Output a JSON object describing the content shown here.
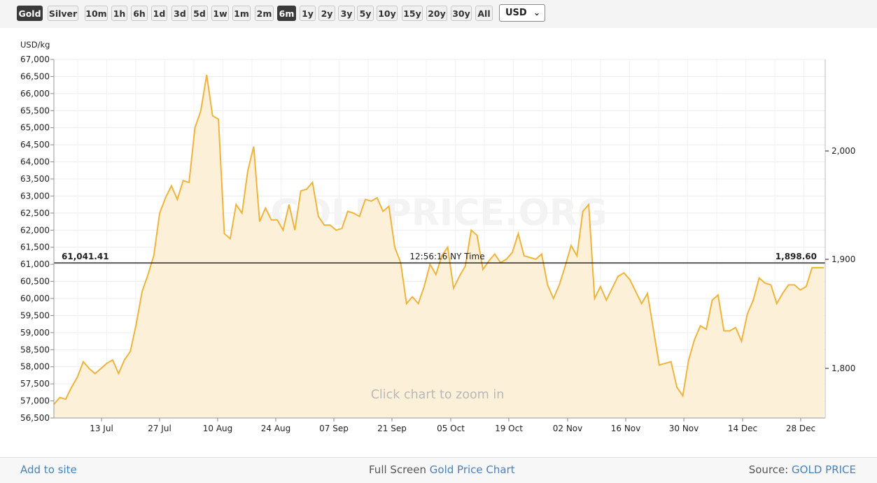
{
  "toolbar": {
    "metals": [
      {
        "label": "Gold",
        "active": true
      },
      {
        "label": "Silver",
        "active": false
      }
    ],
    "ranges": [
      {
        "label": "10m",
        "active": false
      },
      {
        "label": "1h",
        "active": false
      },
      {
        "label": "6h",
        "active": false
      },
      {
        "label": "1d",
        "active": false
      },
      {
        "label": "3d",
        "active": false
      },
      {
        "label": "5d",
        "active": false
      },
      {
        "label": "1w",
        "active": false
      },
      {
        "label": "1m",
        "active": false
      },
      {
        "label": "2m",
        "active": false
      },
      {
        "label": "6m",
        "active": true
      },
      {
        "label": "1y",
        "active": false
      },
      {
        "label": "2y",
        "active": false
      },
      {
        "label": "3y",
        "active": false
      },
      {
        "label": "5y",
        "active": false
      },
      {
        "label": "10y",
        "active": false
      },
      {
        "label": "15y",
        "active": false
      },
      {
        "label": "20y",
        "active": false
      },
      {
        "label": "30y",
        "active": false
      },
      {
        "label": "All",
        "active": false
      }
    ],
    "currency": "USD",
    "currency_icon": "chevron-down-icon"
  },
  "chart_data": {
    "type": "area",
    "ylabel": "USD/kg",
    "ylim": [
      56500,
      67000
    ],
    "y_ticks": [
      56500,
      57000,
      57500,
      58000,
      58500,
      59000,
      59500,
      60000,
      60500,
      61000,
      61500,
      62000,
      62500,
      63000,
      63500,
      64000,
      64500,
      65000,
      65500,
      66000,
      66500,
      67000
    ],
    "y_tick_labels": [
      "56,500",
      "57,000",
      "57,500",
      "58,000",
      "58,500",
      "59,000",
      "59,500",
      "60,000",
      "60,500",
      "61,000",
      "61,500",
      "62,000",
      "62,500",
      "63,000",
      "63,500",
      "64,000",
      "64,500",
      "65,000",
      "65,500",
      "66,000",
      "66,500",
      "67,000"
    ],
    "y2_ticks": [
      1800,
      1900,
      2000
    ],
    "y2_tick_labels": [
      "1,800",
      "1,900",
      "2,000"
    ],
    "x_tick_labels": [
      "13 Jul",
      "27 Jul",
      "10 Aug",
      "24 Aug",
      "07 Sep",
      "21 Sep",
      "05 Oct",
      "19 Oct",
      "02 Nov",
      "16 Nov",
      "30 Nov",
      "14 Dec",
      "28 Dec"
    ],
    "line_color": "#f0b43c",
    "fill_color": "#fdf0d8",
    "current_value": 61041.41,
    "current_value_label": "61,041.41",
    "current_value_usd_oz_label": "1,898.60",
    "crosshair_time": "12:56:16 NY Time",
    "watermark": "GOLDPRICE.ORG",
    "zoom_hint": "Click chart to zoom in",
    "values": [
      56900,
      57100,
      57050,
      57400,
      57700,
      58150,
      57950,
      57800,
      57950,
      58100,
      58200,
      57800,
      58200,
      58450,
      59250,
      60200,
      60700,
      61250,
      62500,
      62950,
      63300,
      62900,
      63450,
      63400,
      65000,
      65500,
      66550,
      65350,
      65250,
      61900,
      61750,
      62750,
      62500,
      63750,
      64450,
      62250,
      62650,
      62300,
      62300,
      62000,
      62750,
      62000,
      63150,
      63200,
      63400,
      62400,
      62150,
      62150,
      62000,
      62050,
      62550,
      62500,
      62400,
      62900,
      62850,
      62950,
      62550,
      62700,
      61500,
      61050,
      59850,
      60050,
      59850,
      60350,
      61000,
      60700,
      61250,
      61500,
      60300,
      60650,
      60950,
      62000,
      61850,
      60850,
      61100,
      61300,
      61050,
      61150,
      61350,
      61900,
      61250,
      61200,
      61150,
      61300,
      60400,
      60000,
      60400,
      60950,
      61550,
      61250,
      62550,
      62750,
      60000,
      60350,
      59950,
      60300,
      60650,
      60750,
      60550,
      60200,
      59850,
      60150,
      59100,
      58050,
      58100,
      58150,
      57400,
      57150,
      58200,
      58800,
      59200,
      59100,
      59950,
      60100,
      59050,
      59050,
      59150,
      58750,
      59550,
      59950,
      60600,
      60450,
      60400,
      59850,
      60150,
      60400,
      60400,
      60250,
      60350,
      60900,
      60900,
      60900
    ]
  },
  "footer": {
    "add_to_site": "Add to site",
    "full_screen_prefix": "Full Screen",
    "full_screen_link": "Gold Price Chart",
    "source_prefix": "Source:",
    "source_link": "GOLD PRICE"
  }
}
